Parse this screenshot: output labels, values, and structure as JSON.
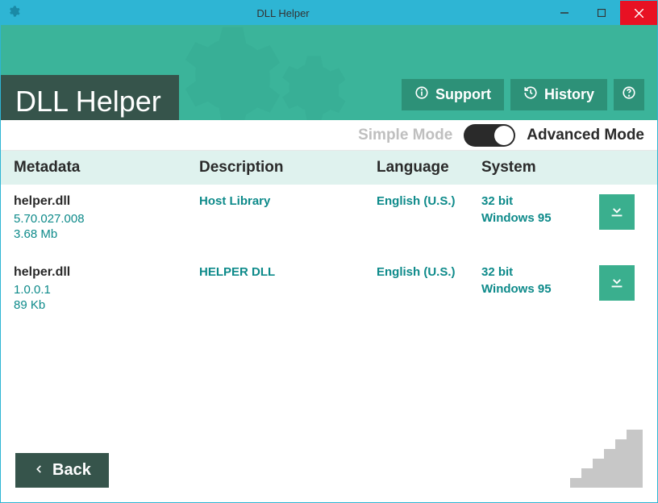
{
  "titlebar": {
    "title": "DLL Helper"
  },
  "header": {
    "app_title": "DLL Helper",
    "support_label": "Support",
    "history_label": "History"
  },
  "mode": {
    "simple_label": "Simple Mode",
    "advanced_label": "Advanced Mode"
  },
  "columns": {
    "metadata": "Metadata",
    "description": "Description",
    "language": "Language",
    "system": "System"
  },
  "rows": [
    {
      "name": "helper.dll",
      "version": "5.70.027.008",
      "size": "3.68 Mb",
      "description": "Host Library",
      "language": "English (U.S.)",
      "bits": "32 bit",
      "os": "Windows 95"
    },
    {
      "name": "helper.dll",
      "version": "1.0.0.1",
      "size": "89 Kb",
      "description": "HELPER DLL",
      "language": "English (U.S.)",
      "bits": "32 bit",
      "os": "Windows 95"
    }
  ],
  "footer": {
    "back_label": "Back"
  }
}
